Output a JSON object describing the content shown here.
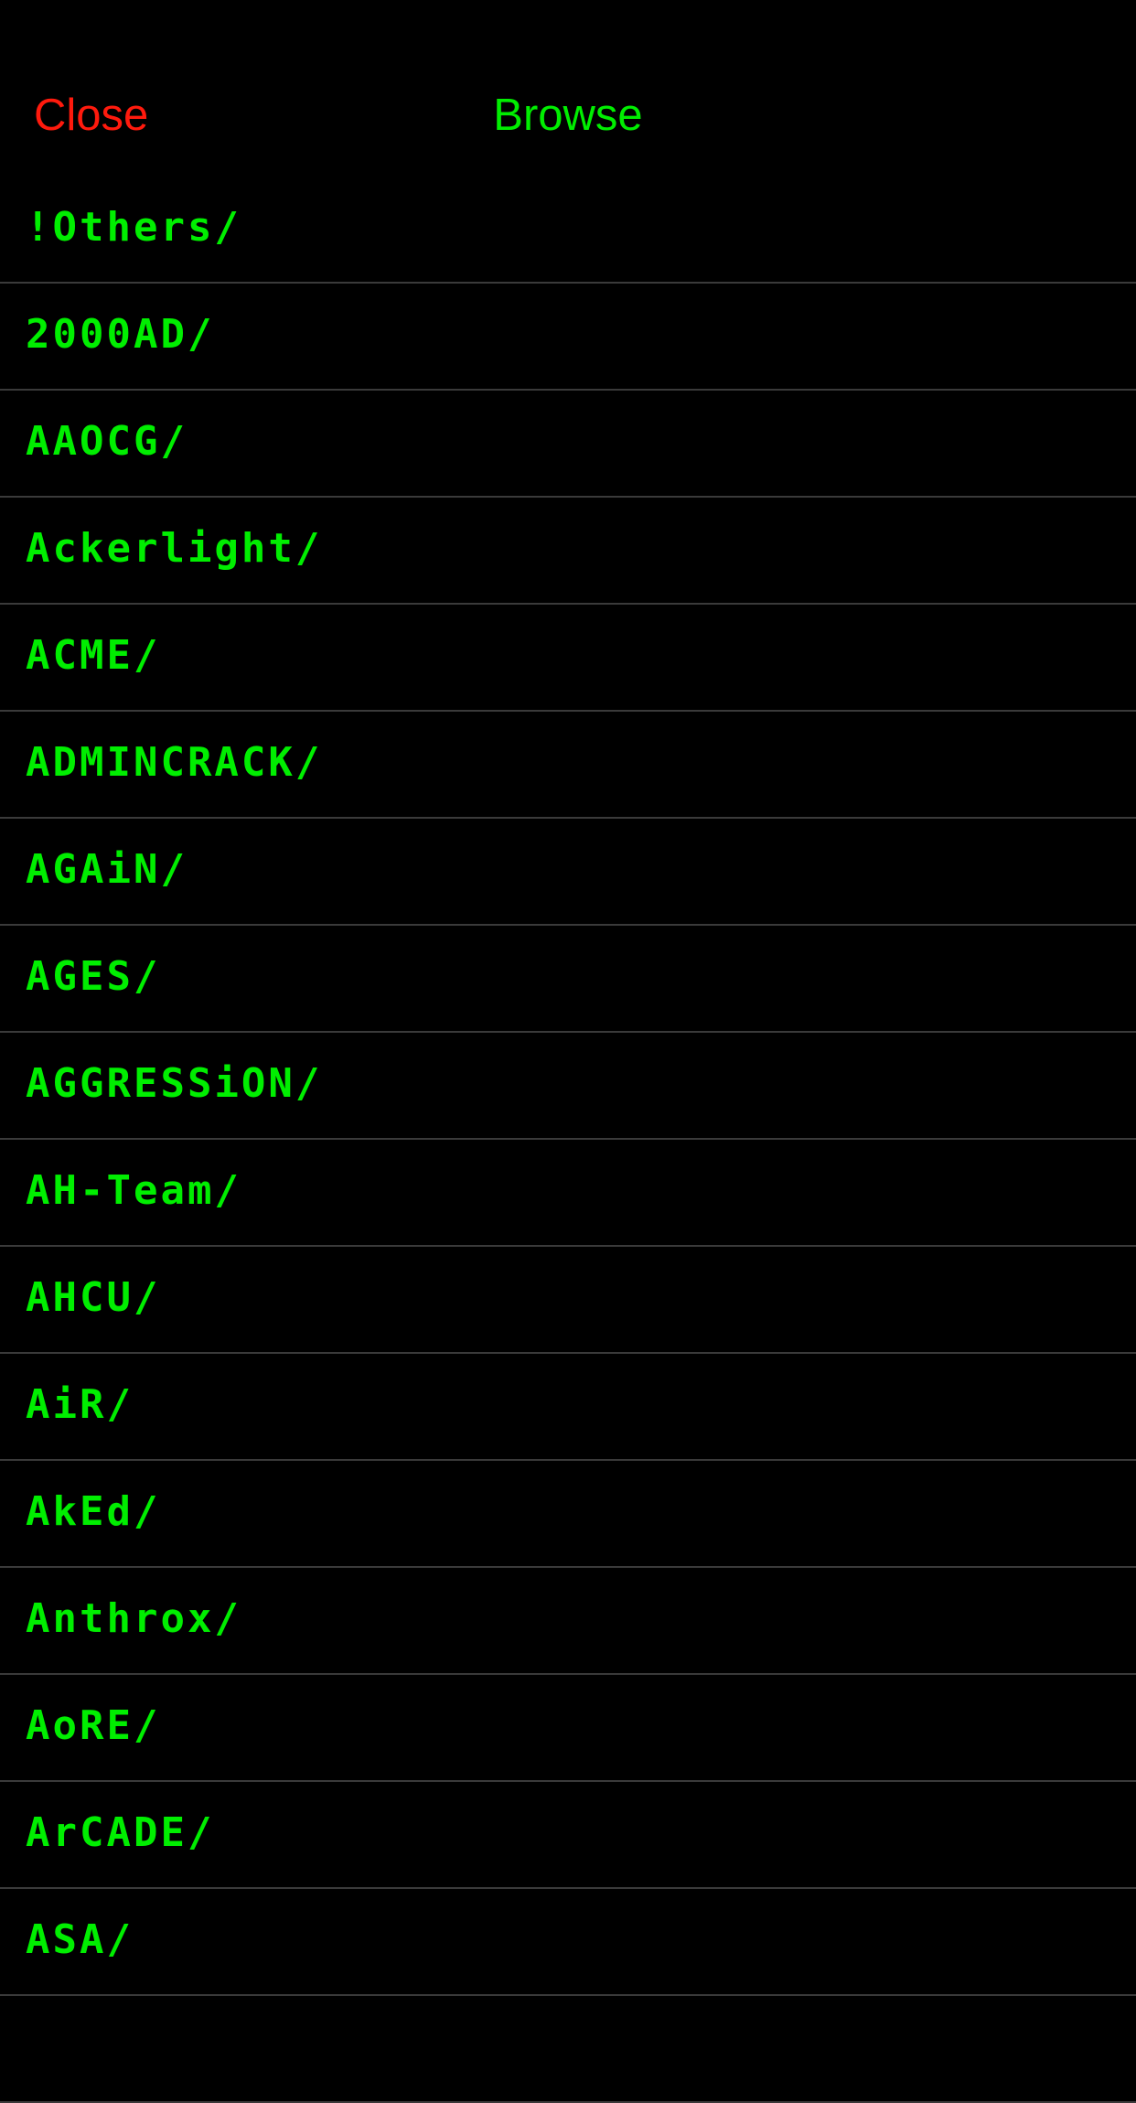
{
  "colors": {
    "background": "#000000",
    "accent": "#00ee00",
    "close": "#ff1a0d",
    "separator": "#3a3a3a"
  },
  "nav": {
    "close_label": "Close",
    "title": "Browse"
  },
  "list": {
    "items": [
      "!Others/",
      "2000AD/",
      "AAOCG/",
      "Ackerlight/",
      "ACME/",
      "ADMINCRACK/",
      "AGAiN/",
      "AGES/",
      "AGGRESSiON/",
      "AH-Team/",
      "AHCU/",
      "AiR/",
      "AkEd/",
      "Anthrox/",
      "AoRE/",
      "ArCADE/",
      "ASA/",
      ""
    ]
  }
}
